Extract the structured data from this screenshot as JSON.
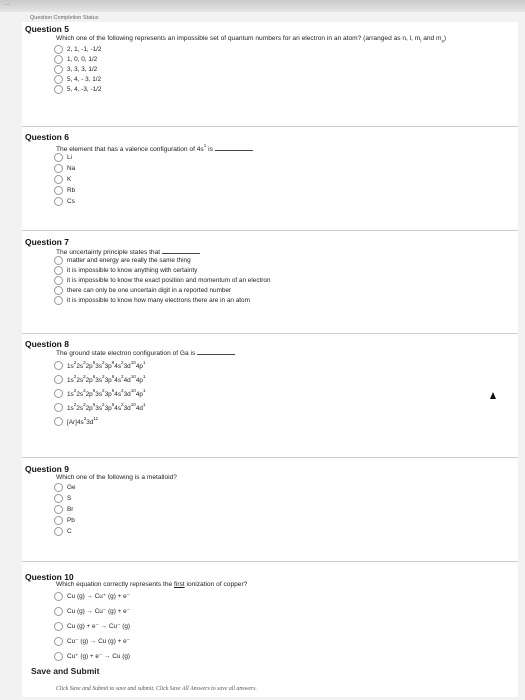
{
  "header": {
    "breadcrumb": "…",
    "status_link": "Question Completion Status"
  },
  "questions": [
    {
      "title": "Question 5",
      "prompt": "Which one of the following represents an impossible set of quantum numbers for an electron in an atom? (arranged as n, l, m",
      "prompt_tail": " and m",
      "prompt_end": ")",
      "sub1": "l",
      "sub2": "s",
      "options": [
        "2, 1, -1, -1/2",
        "1, 0, 0, 1/2",
        "3, 3, 3, 1/2",
        "5, 4, - 3, 1/2",
        "5, 4, -3, -1/2"
      ]
    },
    {
      "title": "Question 6",
      "prompt": "The element that has a valence configuration of 4s",
      "prompt_sup": "1",
      "prompt_after": " is",
      "options": [
        "Li",
        "Na",
        "K",
        "Rb",
        "Cs"
      ]
    },
    {
      "title": "Question 7",
      "prompt": "The uncertainty principle states that",
      "options": [
        "matter and energy are really the same thing",
        "it is impossible to know anything with certainty",
        "it is impossible to know the exact position and momentum of an electron",
        "there can only be one uncertain digit in a reported number",
        "it is impossible to know how many electrons there are in an atom"
      ]
    },
    {
      "title": "Question 8",
      "prompt": "The ground state electron configuration of Ga is",
      "options": [
        [
          [
            "1s",
            "2"
          ],
          [
            "2s",
            "2"
          ],
          [
            "2p",
            "6"
          ],
          [
            "3s",
            "2"
          ],
          [
            "3p",
            "6"
          ],
          [
            "4s",
            "2"
          ],
          [
            "3d",
            "10"
          ],
          [
            "4p",
            "1"
          ]
        ],
        [
          [
            "1s",
            "2"
          ],
          [
            "2s",
            "2"
          ],
          [
            "2p",
            "6"
          ],
          [
            "3s",
            "2"
          ],
          [
            "3p",
            "6"
          ],
          [
            "4s",
            "2"
          ],
          [
            "4d",
            "10"
          ],
          [
            "4p",
            "1"
          ]
        ],
        [
          [
            "1s",
            "2"
          ],
          [
            "2s",
            "2"
          ],
          [
            "2p",
            "6"
          ],
          [
            "3s",
            "2"
          ],
          [
            "3p",
            "6"
          ],
          [
            "4s",
            "2"
          ],
          [
            "3d",
            "10"
          ],
          [
            "4p",
            "1"
          ]
        ],
        [
          [
            "1s",
            "2"
          ],
          [
            "2s",
            "2"
          ],
          [
            "2p",
            "6"
          ],
          [
            "3s",
            "2"
          ],
          [
            "3p",
            "6"
          ],
          [
            "4s",
            "2"
          ],
          [
            "3d",
            "10"
          ],
          [
            "4d",
            "1"
          ]
        ],
        [
          [
            "[Ar]4s",
            "2"
          ],
          [
            "3d",
            "11"
          ]
        ]
      ]
    },
    {
      "title": "Question 9",
      "prompt": "Which one of the following is a metalloid?",
      "options": [
        "Ge",
        "S",
        "Br",
        "Pb",
        "C"
      ]
    },
    {
      "title": "Question 10",
      "prompt_pre": "Which equation correctly represents the ",
      "prompt_u": "first",
      "prompt_post": " ionization of copper?",
      "options": [
        "Cu (g) → Cu⁺ (g) + e⁻",
        "Cu (g) → Cu⁻ (g) + e⁻",
        "Cu (g) + e⁻ → Cu⁻ (g)",
        "Cu⁻ (g) → Cu (g) + e⁻",
        "Cu⁺ (g) + e⁻ → Cu (g)"
      ]
    }
  ],
  "footer": {
    "save_title": "Save and Submit",
    "note_a": "Click ",
    "note_b": "Save and Submit",
    "note_c": " to save and submit. Click ",
    "note_d": "Save All Answers",
    "note_e": " to save all answers."
  }
}
